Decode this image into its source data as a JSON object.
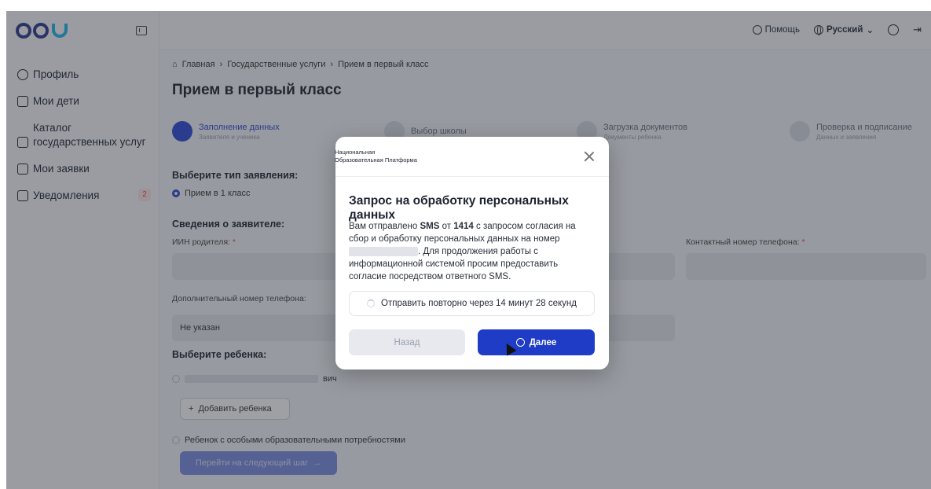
{
  "sidebar": {
    "items": [
      {
        "label": "Профиль",
        "icon": "user-circle-icon"
      },
      {
        "label": "Мои дети",
        "icon": "children-icon"
      },
      {
        "label": "Каталог государственных услуг",
        "icon": "catalog-icon"
      },
      {
        "label": "Мои заявки",
        "icon": "clipboard-icon"
      },
      {
        "label": "Уведомления",
        "icon": "message-icon",
        "badge": "2"
      }
    ]
  },
  "topbar": {
    "help_label": "Помощь",
    "language_label": "Русский"
  },
  "breadcrumb": {
    "home": "Главная",
    "services": "Государственные услуги",
    "current": "Прием в первый класс"
  },
  "page": {
    "title": "Прием в первый класс"
  },
  "stepper": {
    "steps": [
      {
        "title": "Заполнение данных",
        "sub": "Заявителя и ученика"
      },
      {
        "title": "Выбор школы",
        "sub": ""
      },
      {
        "title": "Загрузка документов",
        "sub": "Документы ребенка"
      },
      {
        "title": "Проверка и подписание",
        "sub": "Данных и заявления"
      }
    ]
  },
  "form": {
    "app_type_label": "Выберите тип заявления:",
    "app_type_option": "Прием в 1 класс",
    "applicant_label": "Сведения о заявителе:",
    "iin_label": "ИИН родителя:",
    "required_mark": "*",
    "contact_phone_label": "Контактный номер телефона:",
    "extra_phone_label": "Дополнительный номер телефона:",
    "extra_phone_value": "Не указан",
    "child_label": "Выберите ребенка:",
    "child_suffix": "вич",
    "add_child": "Добавить ребенка",
    "special_needs": "Ребенок с особыми образовательными потребностями",
    "next_step": "Перейти на следующий шаг"
  },
  "modal": {
    "org_line1": "Национальная",
    "org_line2": "Образовательная Платформа",
    "title": "Запрос на обработку персональных данных",
    "text_1": "Вам отправлено ",
    "text_sms": "SMS",
    "text_2": " от ",
    "text_number": "1414",
    "text_3": " с запросом согласия на сбор и обработку персональных данных на номер ",
    "text_4": ". Для продолжения работы с информационной системой просим предоставить согласие посредством ответного SMS.",
    "resend_label": "Отправить повторно через 14 минут 28 секунд",
    "back_label": "Назад",
    "next_label": "Далее"
  },
  "colors": {
    "primary": "#1f3cc7",
    "logo_dark": "#2e3a8c",
    "logo_light": "#22b5e8",
    "badge": "#e04b4b"
  }
}
